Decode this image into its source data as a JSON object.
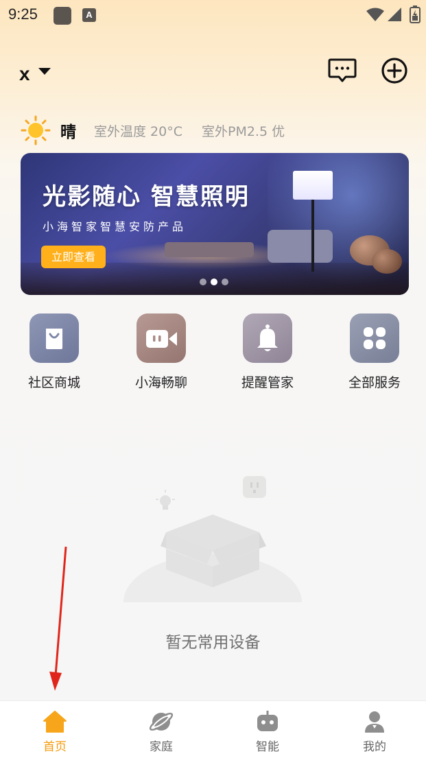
{
  "status_bar": {
    "time": "9:25",
    "notif_letter": "A"
  },
  "header": {
    "home_name": "x"
  },
  "weather": {
    "condition": "晴",
    "outdoor_temp": "室外温度 20°C",
    "outdoor_pm": "室外PM2.5 优",
    "icon": "sun-icon"
  },
  "banner": {
    "title": "光影随心 智慧照明",
    "subtitle": "小海智家智慧安防产品",
    "button_label": "立即查看",
    "slide_count": 3,
    "active_slide": 2
  },
  "services": [
    {
      "label": "社区商城",
      "icon": "shopping-bag-icon",
      "color": "#7f87a8"
    },
    {
      "label": "小海畅聊",
      "icon": "video-call-icon",
      "color": "#a88a85"
    },
    {
      "label": "提醒管家",
      "icon": "bell-icon",
      "color": "#a39aa7"
    },
    {
      "label": "全部服务",
      "icon": "grid-icon",
      "color": "#8d93a6"
    }
  ],
  "empty_state": {
    "text": "暂无常用设备"
  },
  "tabbar": {
    "tabs": [
      {
        "label": "首页",
        "icon": "home-icon",
        "active": true
      },
      {
        "label": "家庭",
        "icon": "planet-icon",
        "active": false
      },
      {
        "label": "智能",
        "icon": "robot-icon",
        "active": false
      },
      {
        "label": "我的",
        "icon": "user-icon",
        "active": false
      }
    ]
  },
  "colors": {
    "accent": "#f59a0a",
    "banner_button": "#ffb01a",
    "annotation_arrow": "#e0261c"
  }
}
